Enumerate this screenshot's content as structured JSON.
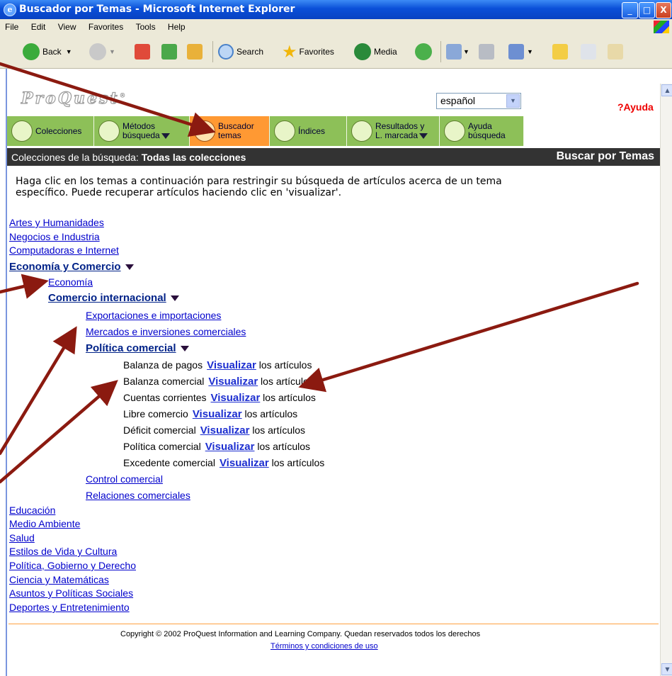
{
  "window": {
    "title": "Buscador por Temas - Microsoft Internet Explorer",
    "minimize": "_",
    "maximize": "□",
    "close": "X"
  },
  "menu": [
    "File",
    "Edit",
    "View",
    "Favorites",
    "Tools",
    "Help"
  ],
  "toolbar": {
    "back": "Back",
    "search": "Search",
    "favorites": "Favorites",
    "media": "Media"
  },
  "header": {
    "logo": "ProQuest",
    "logo_mark": "®",
    "language": "español",
    "help": "?Ayuda"
  },
  "nav": {
    "tabs": [
      {
        "label": "Colecciones"
      },
      {
        "label1": "Métodos",
        "label2": "búsqueda"
      },
      {
        "label1": "Buscador",
        "label2": "temas"
      },
      {
        "label": "Índices"
      },
      {
        "label1": "Resultados y",
        "label2": "L. marcada"
      },
      {
        "label1": "Ayuda",
        "label2": "búsqueda"
      }
    ]
  },
  "collections": {
    "prefix": "Colecciones de la búsqueda:",
    "value": "Todas las colecciones",
    "page_title": "Buscar por Temas"
  },
  "intro": "Haga clic en los temas a continuación para restringir su búsqueda de artículos acerca de un tema específico. Puede recuperar artículos haciendo clic en 'visualizar'.",
  "topics_top": [
    "Artes y Humanidades",
    "Negocios e Industria",
    "Computadoras e Internet"
  ],
  "expanded": {
    "level1": "Economía y Comercio",
    "level2a": "Economía",
    "level2b": "Comercio internacional",
    "level3": [
      "Exportaciones e importaciones",
      "Mercados e inversiones comerciales"
    ],
    "level3_expanded": "Política comercial",
    "leaves": [
      "Balanza de pagos",
      "Balanza comercial",
      "Cuentas corrientes",
      "Libre comercio",
      "Déficit comercial",
      "Política comercial",
      "Excedente comercial"
    ],
    "view_link": "Visualizar",
    "view_suffix": "los artículos",
    "level3_after": [
      "Control comercial",
      "Relaciones comerciales"
    ]
  },
  "topics_bottom": [
    "Educación",
    "Medio Ambiente",
    "Salud",
    "Estilos de Vida y Cultura",
    "Política, Gobierno y Derecho",
    "Ciencia y Matemáticas",
    "Asuntos y Políticas Sociales",
    "Deportes y Entretenimiento"
  ],
  "footer": {
    "copyright": "Copyright © 2002 ProQuest Information and Learning Company. Quedan reservados todos los derechos",
    "terms": "Términos y condiciones de uso"
  },
  "colors": {
    "accent_active_tab": "#ff9933",
    "nav_green": "#99cc66",
    "link": "#0000cc",
    "annotation_arrow": "#8b1a10"
  }
}
